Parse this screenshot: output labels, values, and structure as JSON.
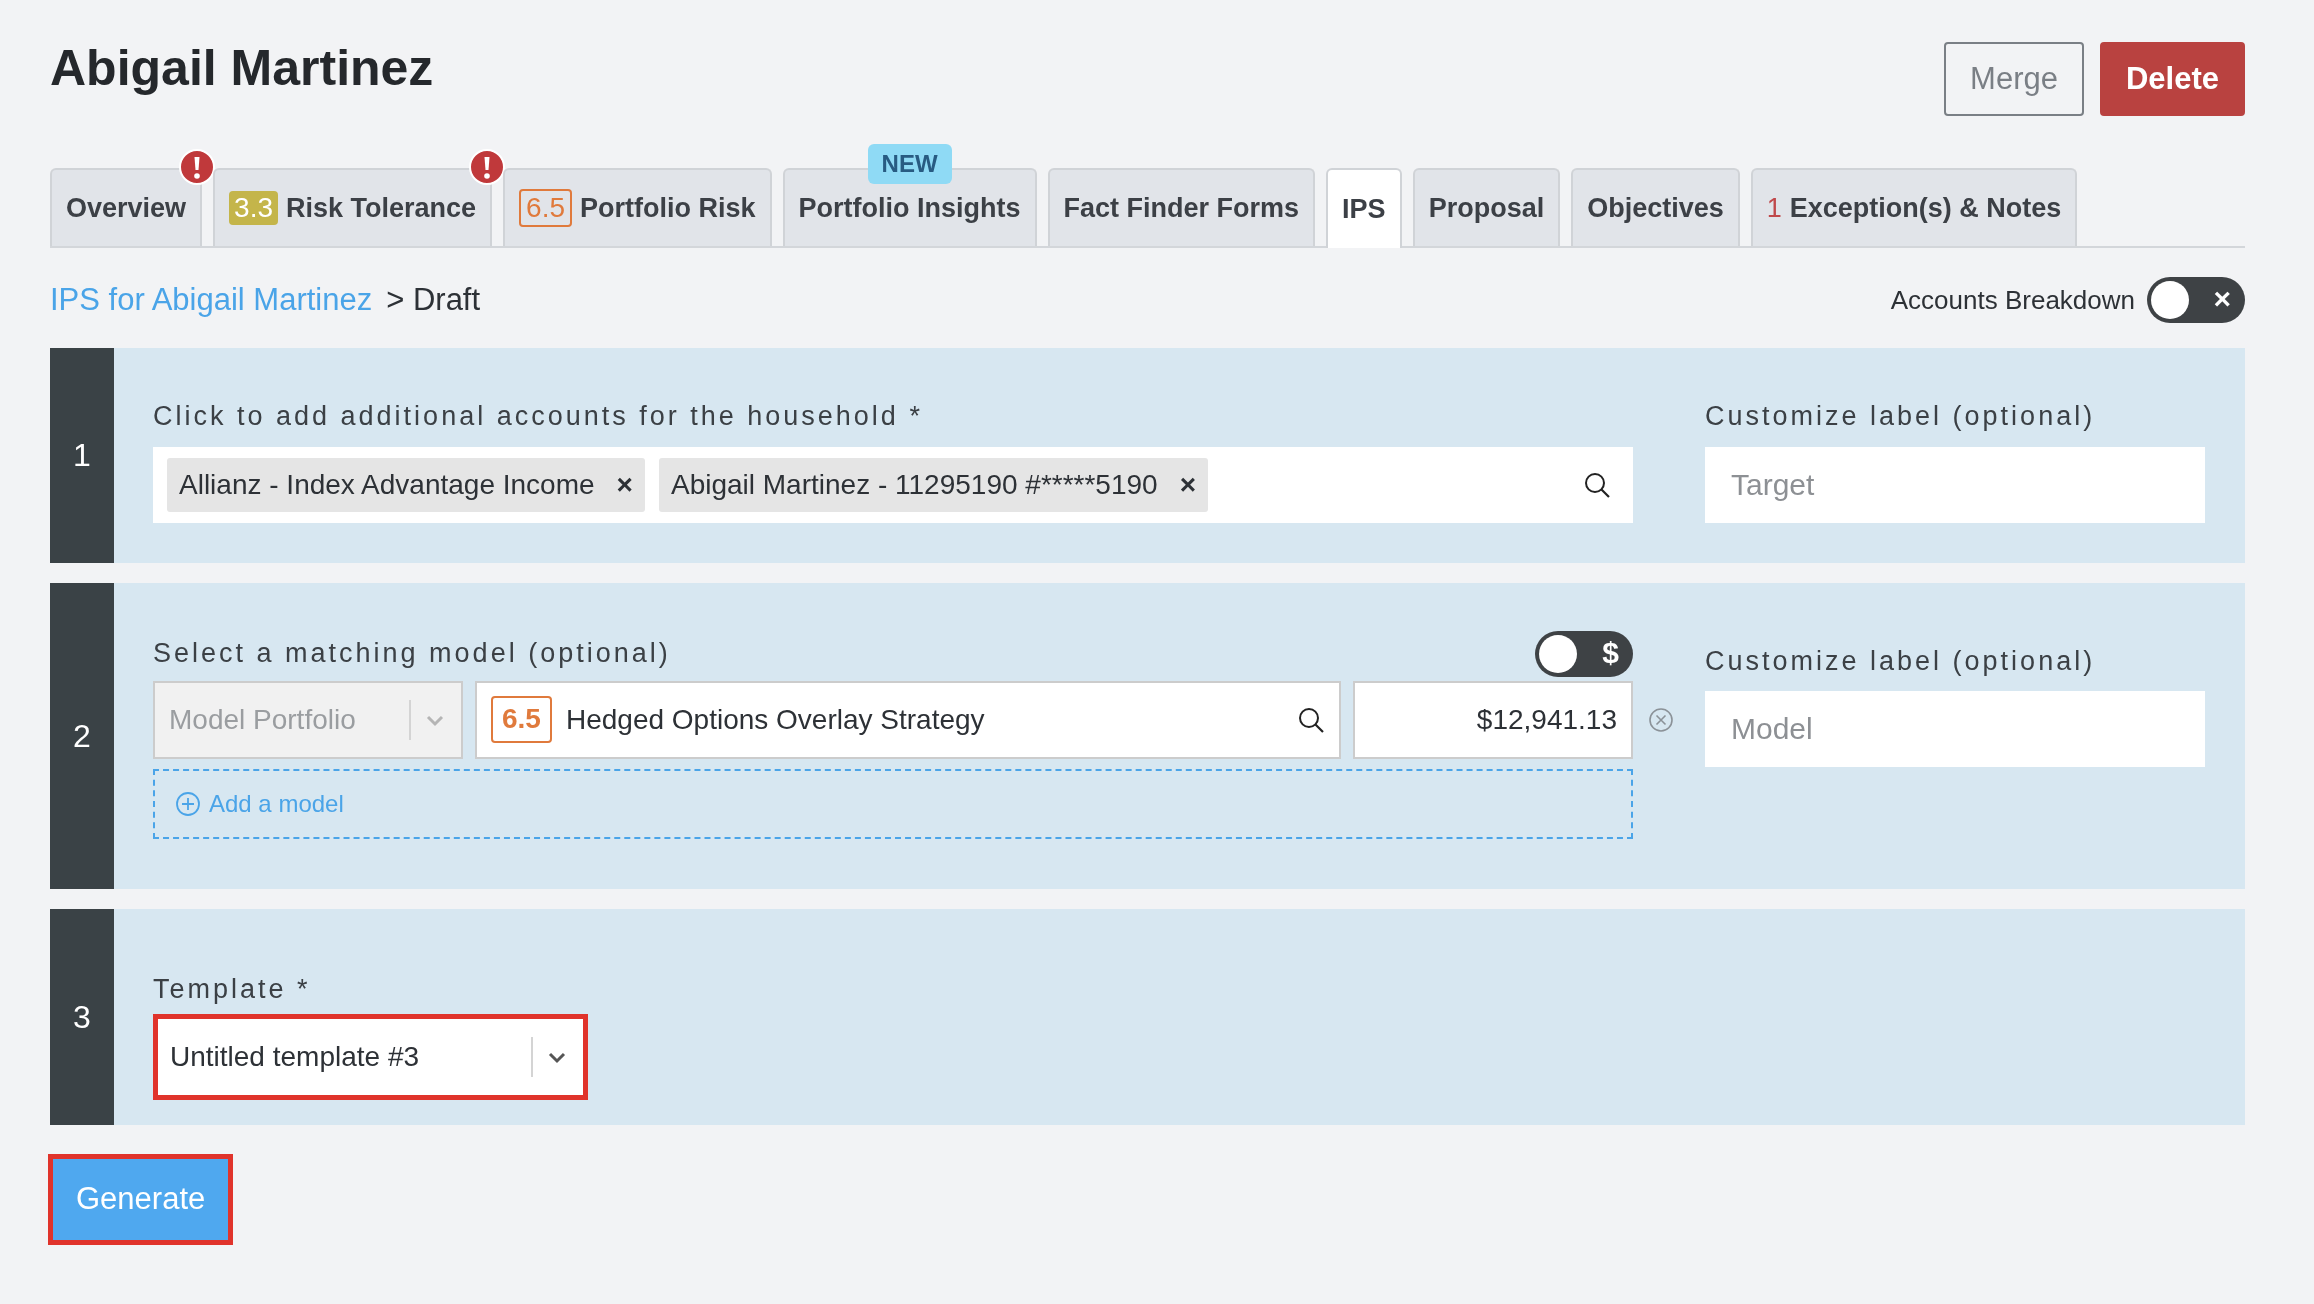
{
  "title": "Abigail Martinez",
  "actions": [
    {
      "label": "Merge",
      "kind": "outline"
    },
    {
      "label": "Delete",
      "kind": "danger"
    }
  ],
  "tabs": [
    {
      "label": "Overview",
      "selected": false,
      "alert": true
    },
    {
      "label": "Risk Tolerance",
      "selected": false,
      "alert": true,
      "score": {
        "value": "3.3",
        "kind": "filled"
      }
    },
    {
      "label": "Portfolio Risk",
      "selected": false,
      "alert": false,
      "score": {
        "value": "6.5",
        "kind": "outline"
      }
    },
    {
      "label": "Portfolio Insights",
      "selected": false,
      "alert": false,
      "flag": "NEW"
    },
    {
      "label": "Fact Finder Forms",
      "selected": false,
      "alert": false
    },
    {
      "label": "IPS",
      "selected": true,
      "alert": false
    },
    {
      "label": "Proposal",
      "selected": false,
      "alert": false
    },
    {
      "label": "Objectives",
      "selected": false,
      "alert": false
    },
    {
      "label": "Exception(s) & Notes",
      "selected": false,
      "alert": false,
      "count": "1"
    }
  ],
  "breadcrumb": {
    "link": "IPS for Abigail Martinez",
    "current": "> Draft"
  },
  "accounts_breakdown": {
    "label": "Accounts Breakdown",
    "on": false,
    "symbol": "×"
  },
  "steps": [
    {
      "number": "1",
      "kind": "accounts",
      "label": "Click to add additional accounts for the household *",
      "tags": [
        {
          "text": "Allianz - Index Advantage Income",
          "remove": "×"
        },
        {
          "text": "Abigail Martinez - 11295190 #*****5190",
          "remove": "×"
        }
      ],
      "custom_label": {
        "label": "Customize label (optional)",
        "placeholder": "Target"
      }
    },
    {
      "number": "2",
      "kind": "model",
      "label": "Select a matching model (optional)",
      "toggle": {
        "on": false,
        "symbol": "$"
      },
      "model_type": {
        "placeholder": "Model Portfolio",
        "disabled": true
      },
      "model": {
        "score": "6.5",
        "value": "Hedged Options Overlay Strategy"
      },
      "amount": "$12,941.13",
      "add_link": "Add a model",
      "custom_label": {
        "label": "Customize label (optional)",
        "placeholder": "Model"
      }
    },
    {
      "number": "3",
      "kind": "template",
      "label": "Template *",
      "value": "Untitled template #3",
      "highlighted": true
    }
  ],
  "generate": {
    "label": "Generate",
    "highlighted": true
  }
}
